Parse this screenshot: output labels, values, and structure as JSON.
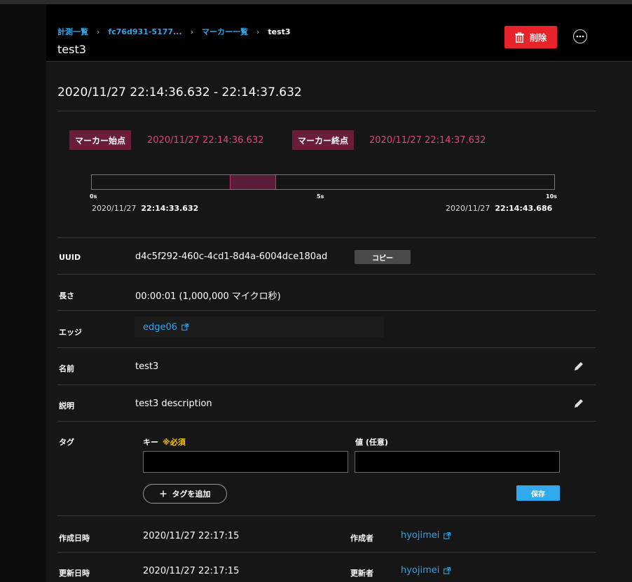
{
  "breadcrumb": {
    "items": [
      "計測一覧",
      "fc76d931-5177...",
      "マーカー一覧"
    ],
    "separator": "›",
    "current": "test3"
  },
  "header": {
    "title": "test3",
    "delete_label": "削除",
    "more_icon": "more-horizontal-icon"
  },
  "range_title": "2020/11/27 22:14:36.632 - 22:14:37.632",
  "markers": {
    "start_label": "マーカー始点",
    "start_time": "2020/11/27 22:14:36.632",
    "end_label": "マーカー終点",
    "end_time": "2020/11/27 22:14:37.632"
  },
  "timeline": {
    "ticks": [
      "0s",
      "5s",
      "10s"
    ],
    "selection_start_s": 3.0,
    "selection_end_s": 4.0,
    "duration_s": 10.054,
    "start_date": "2020/11/27",
    "start_time": "22:14:33.632",
    "end_date": "2020/11/27",
    "end_time": "22:14:43.686"
  },
  "details": {
    "uuid_label": "UUID",
    "uuid_value": "d4c5f292-460c-4cd1-8d4a-6004dce180ad",
    "copy_label": "コピー",
    "length_label": "長さ",
    "length_value": "00:00:01 (1,000,000 マイクロ秒)",
    "edge_label": "エッジ",
    "edge_value": "edge06",
    "name_label": "名前",
    "name_value": "test3",
    "desc_label": "説明",
    "desc_value": "test3 description"
  },
  "tags": {
    "label": "タグ",
    "key_label": "キー",
    "required_label": "※必須",
    "value_label": "値 (任意)",
    "key_input": "",
    "value_input": "",
    "add_label": "タグを追加",
    "save_label": "保存"
  },
  "meta": {
    "created_label": "作成日時",
    "created_value": "2020/11/27 22:17:15",
    "creator_label": "作成者",
    "creator_value": "hyojimei",
    "updated_label": "更新日時",
    "updated_value": "2020/11/27 22:17:15",
    "updater_label": "更新者",
    "updater_value": "hyojimei"
  },
  "colors": {
    "accent": "#34a3e6",
    "danger": "#e8232b",
    "marker": "#6a1c38",
    "marker_text": "#e0457e",
    "required": "#ffc000",
    "save": "#30a9ef"
  }
}
